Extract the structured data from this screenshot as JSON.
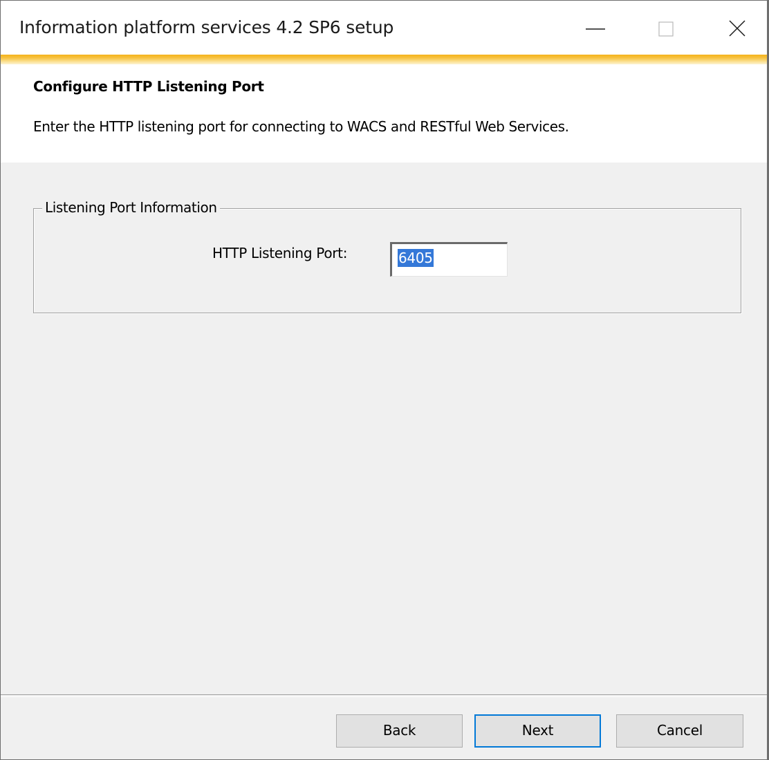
{
  "window": {
    "title": "Information platform services 4.2 SP6 setup"
  },
  "header": {
    "title": "Configure HTTP Listening Port",
    "description": "Enter the HTTP listening port for connecting to WACS and RESTful Web Services."
  },
  "port_group": {
    "legend": "Listening Port Information",
    "port_label": "HTTP Listening Port:",
    "port_value": "6405"
  },
  "buttons": {
    "back": "Back",
    "next": "Next",
    "cancel": "Cancel"
  },
  "colors": {
    "accent": "#f5b31a",
    "selection": "#3478d8",
    "default_button_border": "#0078d7"
  }
}
